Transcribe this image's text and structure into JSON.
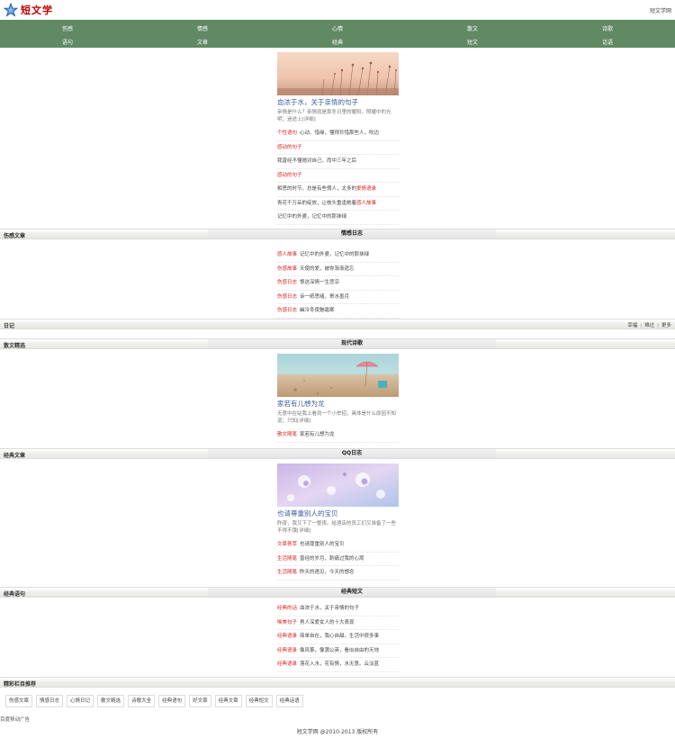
{
  "header": {
    "logo_text": "短文学",
    "site_link": "短文学网"
  },
  "nav": {
    "row1": [
      "伤感",
      "情感",
      "心情",
      "散文",
      "诗歌"
    ],
    "row2": [
      "语句",
      "文章",
      "经典",
      "短文",
      "话语"
    ]
  },
  "section1": {
    "feature": {
      "title": "血浓于水，关于亲情的句子",
      "desc": "亲情是什么？亲情就是那冬日里的暖阳，照耀中的光明；迷途上[详细]"
    },
    "list": [
      {
        "cat": "个性语句",
        "text": "心动、惜缘，懂得珍惜那些人，吹边"
      },
      {
        "text": "感动的句子",
        "red": true
      },
      {
        "text": "我曾经不懂她对自己，而中三年之后"
      },
      {
        "text": "感动的句子",
        "red": true
      },
      {
        "pre": "相思的时节，总是有些惆人，太多的",
        "hl": "爱情语录"
      },
      {
        "pre": "青花千万朵的绽放，让枝头重逢她着",
        "hl": "感人故事"
      },
      {
        "text": "记忆中的外婆，记忆中的那抹绿"
      }
    ]
  },
  "bar1": {
    "left": "伤感文章",
    "center": "情感日志"
  },
  "section2": {
    "list": [
      {
        "cat": "感人故事",
        "text": "记忆中的外婆，记忆中的那抹绿"
      },
      {
        "cat": "伤感故事",
        "text": "天使的爱，被你渐渐遗忘"
      },
      {
        "cat": "伤感日志",
        "text": "恨这深情一生悲凉"
      },
      {
        "cat": "伤感日志",
        "text": "诉一纸思绪，寄水墨月"
      },
      {
        "cat": "伤感日志",
        "text": "幽冷冬夜魅霜寒"
      }
    ]
  },
  "bar_diary": {
    "left": "日记",
    "links": [
      "幸福",
      "难过",
      "更多"
    ]
  },
  "bar2": {
    "left": "散文精选",
    "center": "现代诗歌"
  },
  "section3": {
    "feature": {
      "title": "家若有儿想为龙",
      "desc": "无意中在站我上看到一个小举招，具体是什么原因不知道；只知[详细]"
    },
    "list": [
      {
        "cat": "散文随笔",
        "text": "家若有儿想为龙"
      }
    ]
  },
  "bar3": {
    "left": "经典文章",
    "center": "QQ日志"
  },
  "section4": {
    "feature": {
      "title": "也请尊重别人的宝贝",
      "desc": "昨夜，我又下了一整夜。给酒店的员工们又准备了一些不得不饿[详细]"
    },
    "list": [
      {
        "cat": "文章荟萃",
        "text": "也请尊重别人的宝贝"
      },
      {
        "cat": "生活随笔",
        "text": "曾经的岁月，刺痛过我的心窝"
      },
      {
        "cat": "生活随笔",
        "text": "昨天的遇见，今天的想念"
      }
    ]
  },
  "bar4": {
    "left": "经典语句",
    "center": "经典短文"
  },
  "section5": {
    "list": [
      {
        "cat": "经典的话",
        "text": "血浓于水，关于亲情的句子"
      },
      {
        "cat": "唯美句子",
        "text": "男人深爱女人的十大表现"
      },
      {
        "cat": "经典语录",
        "text": "简单自在，我心自甜。生活中很多事"
      },
      {
        "cat": "经典语录",
        "text": "像风筝，像蒲公英，看似自由的天地"
      },
      {
        "cat": "经典语录",
        "text": "落花入水，花有情，水无意。云淡蓝"
      }
    ]
  },
  "bar5": {
    "left": "精彩栏目推荐"
  },
  "recommend": [
    "伤感文章",
    "情感日志",
    "心情日记",
    "散文精选",
    "诗歌大全",
    "经典语句",
    "好文章",
    "经典文章",
    "经典短文",
    "经典话语"
  ],
  "ad": "百度移动广告",
  "footer": "短文学网 @2010-2013 版权所有"
}
